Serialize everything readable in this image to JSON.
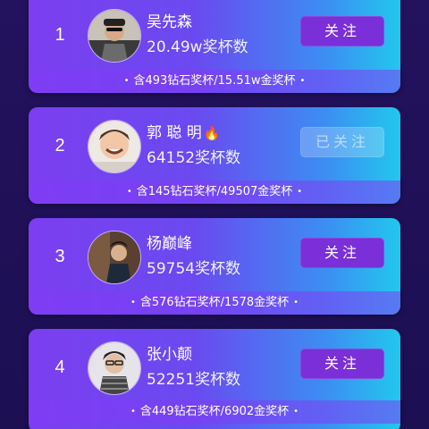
{
  "list": [
    {
      "rank": "1",
      "name": "吴先森",
      "count": "20.49w奖杯数",
      "follow_label": "关注",
      "followed": false,
      "summary": "含493钻石奖杯/15.51w金奖杯",
      "avatar_icon": "user-avatar-icon"
    },
    {
      "rank": "2",
      "name": "郭 聪 明",
      "name_emoji": "🔥",
      "count": "64152奖杯数",
      "follow_label": "已关注",
      "followed": true,
      "summary": "含145钻石奖杯/49507金奖杯",
      "avatar_icon": "user-avatar-icon"
    },
    {
      "rank": "3",
      "name": "杨巅峰",
      "count": "59754奖杯数",
      "follow_label": "关注",
      "followed": false,
      "summary": "含576钻石奖杯/1578金奖杯",
      "avatar_icon": "user-avatar-icon"
    },
    {
      "rank": "4",
      "name": "张小颠",
      "count": "52251奖杯数",
      "follow_label": "关注",
      "followed": false,
      "summary": "含449钻石奖杯/6902金奖杯",
      "avatar_icon": "user-avatar-icon"
    }
  ],
  "separator_glyph": "•",
  "colors": {
    "card_gradient_start": "#7c3ef0",
    "card_gradient_end": "#22c7ee",
    "follow_button": "#7a2fd8",
    "followed_button": "#b9a6e8",
    "background": "#1c0f52"
  }
}
